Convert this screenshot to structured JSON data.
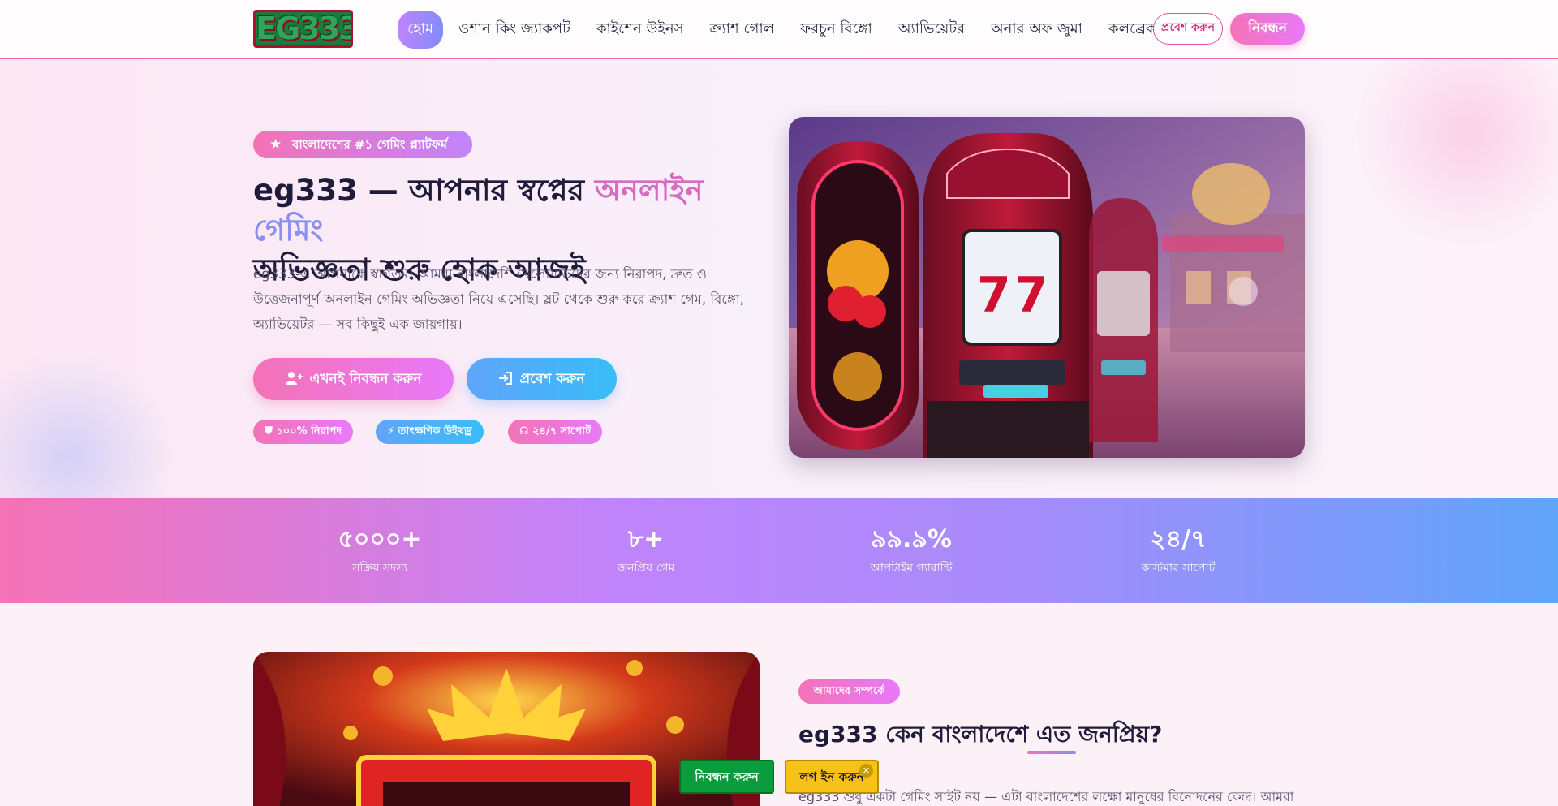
{
  "colors": {
    "brand_pink": "#f472b6",
    "brand_purple": "#c084fc",
    "brand_blue": "#60a5fa",
    "sticky_register": "#0a9b3c",
    "sticky_login": "#f6c21a"
  },
  "nav": {
    "logo_text": "EG333",
    "items": [
      {
        "label": "হোম",
        "active": true
      },
      {
        "label": "ওশান কিং জ্যাকপট"
      },
      {
        "label": "কাইশেন উইনস"
      },
      {
        "label": "ক্র্যাশ গোল"
      },
      {
        "label": "ফরচুন বিঙ্গো"
      },
      {
        "label": "অ্যাভিয়েটর"
      },
      {
        "label": "অনার অফ জুমা"
      },
      {
        "label": "কলব্রেক"
      }
    ],
    "login_label": "প্রবেশ করুন",
    "register_label": "নিবন্ধন"
  },
  "hero": {
    "badge_icon": "star-icon",
    "badge": "বাংলাদেশের #১ গেমিং প্ল্যাটফর্ম",
    "title_part1": "eg333 — আপনার স্বপ্নের ",
    "title_highlight1": "অনলাইন",
    "title_highlight2": "গেমিং",
    "title_part2": "অভিজ্ঞতা শুরু হোক আজই",
    "description": "eg333-এ আপনাকে স্বাগতম! আমরা বাংলাদেশি খেলোয়াড়দের জন্য নিরাপদ, দ্রুত ও উত্তেজনাপূর্ণ অনলাইন গেমিং অভিজ্ঞতা নিয়ে এসেছি। স্লট থেকে শুরু করে ক্র্যাশ গেম, বিঙ্গো, অ্যাভিয়েটর — সব কিছুই এক জায়গায়।",
    "register_button": "এখনই নিবন্ধন করুন",
    "register_icon": "user-plus-icon",
    "login_button": "প্রবেশ করুন",
    "login_icon": "sign-in-icon",
    "features": [
      {
        "icon": "shield-icon",
        "label": "১০০% নিরাপদ"
      },
      {
        "icon": "bolt-icon",
        "label": "তাৎক্ষণিক উইথড্র"
      },
      {
        "icon": "headset-icon",
        "label": "২৪/৭ সাপোর্ট"
      }
    ]
  },
  "stats": [
    {
      "value": "৫০০০+",
      "label": "সক্রিয় সদস্য"
    },
    {
      "value": "৮+",
      "label": "জনপ্রিয় গেম"
    },
    {
      "value": "৯৯.৯%",
      "label": "আপটাইম গ্যারান্টি"
    },
    {
      "value": "২৪/৭",
      "label": "কাস্টমার সাপোর্ট"
    }
  ],
  "about": {
    "tag": "আমাদের সম্পর্কে",
    "title": "eg333 কেন বাংলাদেশে এত জনপ্রিয়?",
    "text": "eg333 শুধু একটা গেমিং সাইট নয় — এটা বাংলাদেশের লক্ষো মানুষের বিনোদনের কেন্দ্র। আমরা"
  },
  "sticky": {
    "register_label": "নিবন্ধন করুন",
    "login_label": "লগ ইন করুন",
    "close_symbol": "✕"
  }
}
